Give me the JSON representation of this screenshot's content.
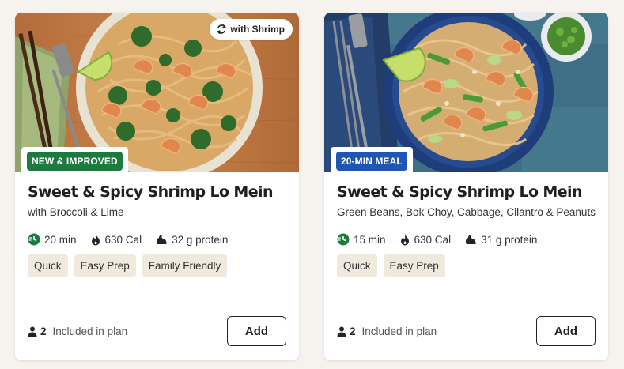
{
  "recipes": [
    {
      "badge": "NEW & IMPROVED",
      "badge_color": "#1d7a3f",
      "swap_label": "with Shrimp",
      "title": "Sweet & Spicy Shrimp Lo Mein",
      "subtitle": "with Broccoli & Lime",
      "time": "20 min",
      "calories": "630 Cal",
      "protein": "32 g protein",
      "tags": [
        "Quick",
        "Easy Prep",
        "Family Friendly"
      ],
      "servings": "2",
      "plan_label": "Included in plan",
      "add_label": "Add"
    },
    {
      "badge": "20-MIN MEAL",
      "badge_color": "#1f56b3",
      "title": "Sweet & Spicy Shrimp Lo Mein",
      "subtitle": "Green Beans, Bok Choy, Cabbage, Cilantro & Peanuts",
      "time": "15 min",
      "calories": "630 Cal",
      "protein": "31 g protein",
      "tags": [
        "Quick",
        "Easy Prep"
      ],
      "servings": "2",
      "plan_label": "Included in plan",
      "add_label": "Add"
    }
  ],
  "colors": {
    "page_bg": "#f6f3ef",
    "tag_bg": "#f0e9de",
    "time_icon": "#1d7a3f"
  },
  "icons": [
    "swap-icon",
    "clock-icon",
    "flame-icon",
    "protein-icon",
    "person-icon"
  ]
}
